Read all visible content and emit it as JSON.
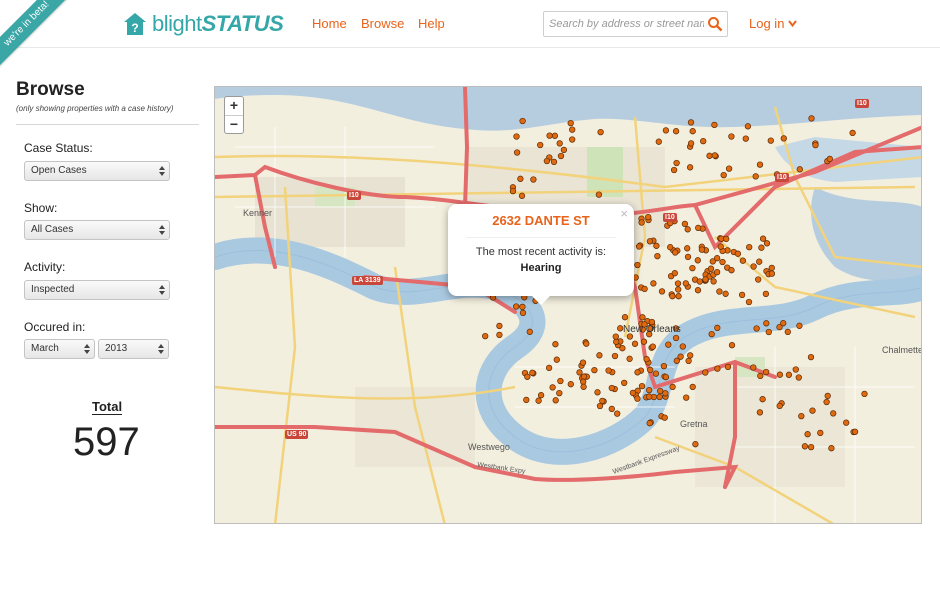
{
  "header": {
    "beta": "we're in beta!",
    "logo_light": "blight",
    "logo_bold": "STATUS",
    "nav": [
      "Home",
      "Browse",
      "Help"
    ],
    "search_placeholder": "Search by address or street name",
    "login": "Log in"
  },
  "sidebar": {
    "title": "Browse",
    "subtitle": "(only showing properties with a case history)",
    "case_status_label": "Case Status:",
    "case_status_value": "Open Cases",
    "show_label": "Show:",
    "show_value": "All Cases",
    "activity_label": "Activity:",
    "activity_value": "Inspected",
    "occured_label": "Occured in:",
    "month_value": "March",
    "year_value": "2013",
    "total_label": "Total",
    "total_value": "597"
  },
  "map": {
    "zoom_in": "+",
    "zoom_out": "−",
    "labels": {
      "kenner": "Kenner",
      "new_orleans": "New Orleans",
      "westwego": "Westwego",
      "gretna": "Gretna",
      "chalmette": "Chalmette",
      "westbank_expy": "Westbank Expy",
      "westbank_expressway": "Westbank Expressway"
    },
    "shields": {
      "i10_a": "I10",
      "i10_b": "I10",
      "i10_c": "I10",
      "i10_d": "I10",
      "la3139": "LA 3139",
      "us90": "US 90"
    },
    "popup": {
      "close": "×",
      "address": "2632 DANTE ST",
      "text": "The most recent activity is:",
      "activity": "Hearing"
    },
    "colors": {
      "water": "#b6cde0",
      "river": "#a9c9e1",
      "land": "#f3efdf",
      "highway": "#e36b6b",
      "marker": "#e06a10"
    }
  }
}
